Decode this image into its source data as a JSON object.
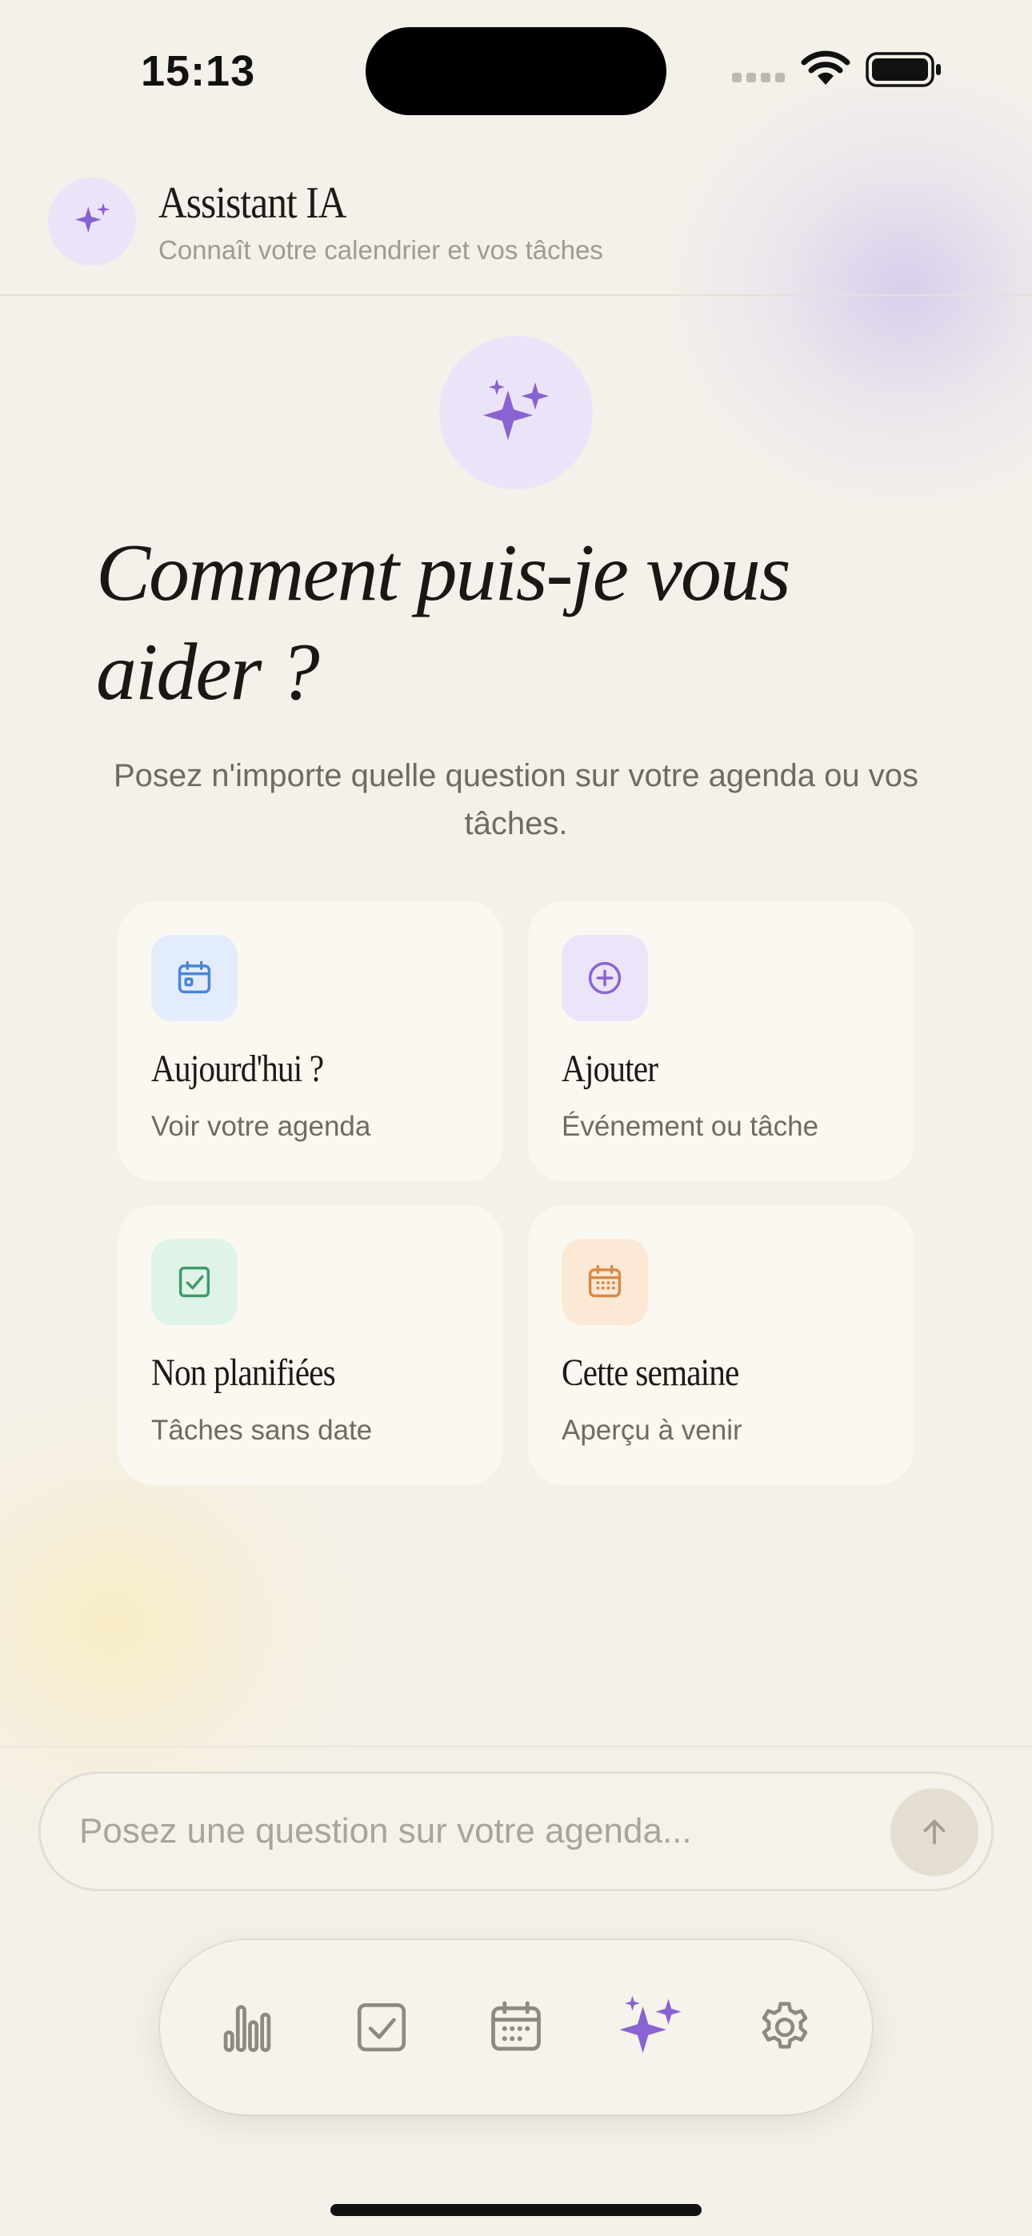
{
  "status_bar": {
    "time": "15:13"
  },
  "header": {
    "title": "Assistant IA",
    "subtitle": "Connaît votre calendrier et vos tâches"
  },
  "hero": {
    "title": "Comment puis-je vous aider ?",
    "subtitle": "Posez n'importe quelle question sur votre agenda ou vos tâches."
  },
  "suggestions": [
    {
      "title": "Aujourd'hui ?",
      "subtitle": "Voir votre agenda",
      "icon": "calendar-today-icon",
      "color": "#4a86d6",
      "bg": "#e3ecfa"
    },
    {
      "title": "Ajouter",
      "subtitle": "Événement ou tâche",
      "icon": "plus-circle-icon",
      "color": "#8a63d2",
      "bg": "#ece4f9"
    },
    {
      "title": "Non planifiées",
      "subtitle": "Tâches sans date",
      "icon": "checkbox-icon",
      "color": "#3f9a6b",
      "bg": "#e0f3e8"
    },
    {
      "title": "Cette semaine",
      "subtitle": "Aperçu à venir",
      "icon": "calendar-week-icon",
      "color": "#d88a45",
      "bg": "#fbe9d6"
    }
  ],
  "composer": {
    "placeholder": "Posez une question sur votre agenda...",
    "send_icon": "arrow-up-icon"
  },
  "tabs": [
    {
      "icon": "bar-chart-icon",
      "active": false
    },
    {
      "icon": "checkbox-icon",
      "active": false
    },
    {
      "icon": "calendar-icon",
      "active": false
    },
    {
      "icon": "sparkles-icon",
      "active": true
    },
    {
      "icon": "gear-icon",
      "active": false
    }
  ],
  "colors": {
    "accent": "#8a63d2",
    "background": "#f4f0ea",
    "tab_inactive": "#8e8982"
  }
}
